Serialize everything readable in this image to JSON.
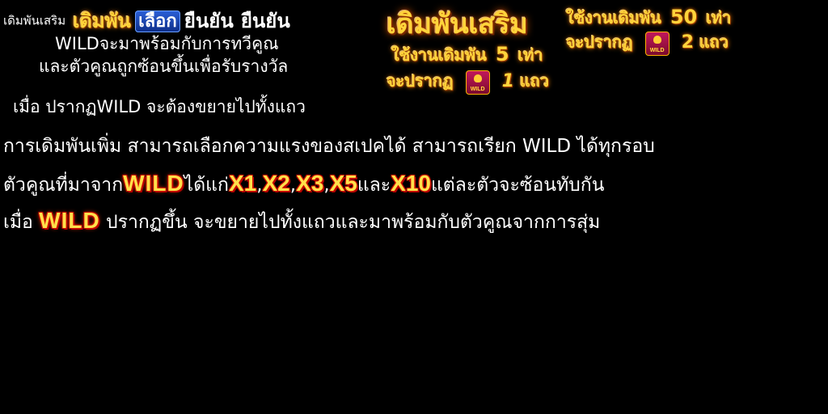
{
  "top": {
    "label_small": "เดิมพันเสริม",
    "label_gold": "เดิมพัน",
    "button_select": "เลือก",
    "confirm_1": "ยืนยัน",
    "confirm_2": "ยืนยัน",
    "title_extra_bet": "เดิมพันเสริม"
  },
  "wild_info": {
    "line1": "WILDจะมาพร้อมกับการทวีคูณ",
    "line2": "และตัวคูณถูกซ้อนขึ้นเพื่อรับรางวัล",
    "line3": "เมื่อ ปรากฏWILD จะต้องขยายไปทั้งแถว"
  },
  "bet5": {
    "prefix": "ใช้งานเดิมพัน",
    "num": "5",
    "suffix": "เท่า",
    "appear": "จะปรากฏ",
    "count": "1",
    "rows": "แถว"
  },
  "bet50": {
    "prefix": "ใช้งานเดิมพัน",
    "num": "50",
    "suffix": "เท่า",
    "appear": "จะปรากฏ",
    "count": "2",
    "rows": "แถว"
  },
  "desc": {
    "l1": "การเดิมพันเพิ่ม สามารถเลือกความแรงของสเปคได้ สามารถเรียก WILD ได้ทุกรอบ",
    "l2_a": "ตัวคูณที่มาจาก",
    "l2_wild": "WILD",
    "l2_b": "ได้แก่",
    "m1": "X1",
    "sep1": ",",
    "m2": "X2",
    "sep2": ",",
    "m3": "X3",
    "sep3": ",",
    "m5": "X5",
    "l2_c": "และ",
    "m10": "X10",
    "l2_d": "แต่ละตัวจะซ้อนทับกัน",
    "l3_a": "เมื่อ",
    "l3_wild": "WILD",
    "l3_b": "ปรากฏขึ้น จะขยายไปทั้งแถวและมาพร้อมกับตัวคูณจากการสุ่ม"
  }
}
